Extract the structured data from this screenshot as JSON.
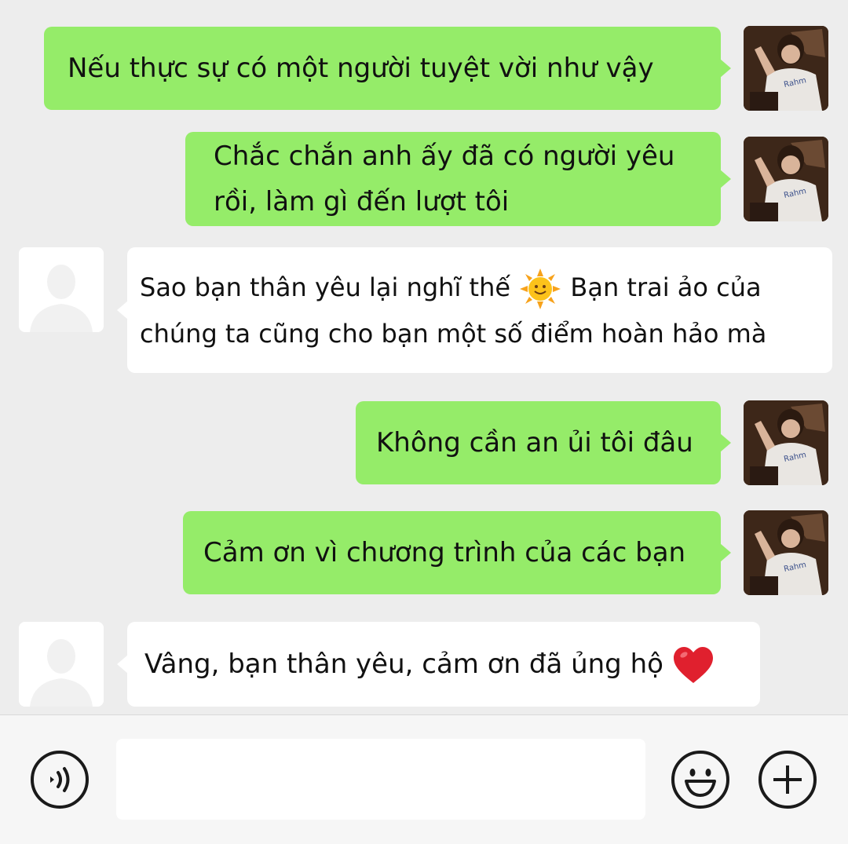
{
  "messages": [
    {
      "side": "out",
      "text": "Nếu thực sự có một người tuyệt vời như vậy"
    },
    {
      "side": "out",
      "lines": [
        "Chắc chắn anh ấy đã có người yêu",
        "rồi, làm gì đến lượt tôi"
      ]
    },
    {
      "side": "in",
      "line1_before": "Sao bạn thân yêu lại nghĩ thế",
      "line1_emoji": "sun-face-icon",
      "line1_after": "Bạn trai ảo của",
      "line2": "chúng ta cũng cho bạn một số điểm hoàn hảo mà"
    },
    {
      "side": "out",
      "text": "Không cần an ủi tôi đâu"
    },
    {
      "side": "out",
      "text": "Cảm ơn vì chương trình của các bạn"
    },
    {
      "side": "in",
      "text": "Vâng, bạn thân yêu, cảm ơn đã ủng hộ",
      "emoji": "red-heart-icon"
    }
  ],
  "input": {
    "value": "",
    "placeholder": ""
  },
  "icons": {
    "voice": "voice-input-icon",
    "emoji": "emoji-icon",
    "more": "plus-icon"
  },
  "colors": {
    "outgoing_bubble": "#95ec69",
    "incoming_bubble": "#ffffff",
    "background": "#ededed"
  }
}
